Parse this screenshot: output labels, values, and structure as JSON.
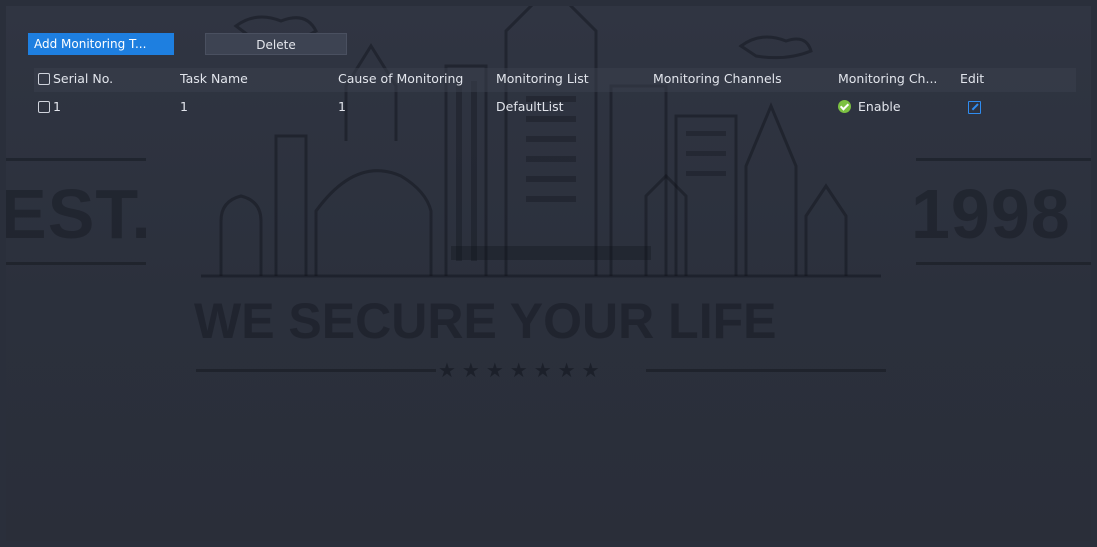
{
  "toolbar": {
    "add_label": "Add Monitoring T...",
    "delete_label": "Delete"
  },
  "table": {
    "columns": {
      "serial": "Serial No.",
      "task_name": "Task Name",
      "cause": "Cause of Monitoring",
      "list": "Monitoring List",
      "channels": "Monitoring Channels",
      "status": "Monitoring Ch...",
      "edit": "Edit"
    },
    "rows": [
      {
        "serial": "1",
        "task_name": "1",
        "cause": "1",
        "list": "DefaultList",
        "channels": "",
        "status": "Enable",
        "checked": false
      }
    ]
  },
  "watermark": {
    "left_text": "EST.",
    "right_text": "1998",
    "slogan": "WE SECURE YOUR LIFE",
    "stars": "★★★★★★★"
  },
  "icons": {
    "status": "check-circle-icon",
    "edit": "edit-icon"
  },
  "colors": {
    "accent": "#1e7fe0",
    "status_ok": "#7cc142",
    "edit_icon": "#2f8cf0",
    "background": "#2a2f3b"
  }
}
